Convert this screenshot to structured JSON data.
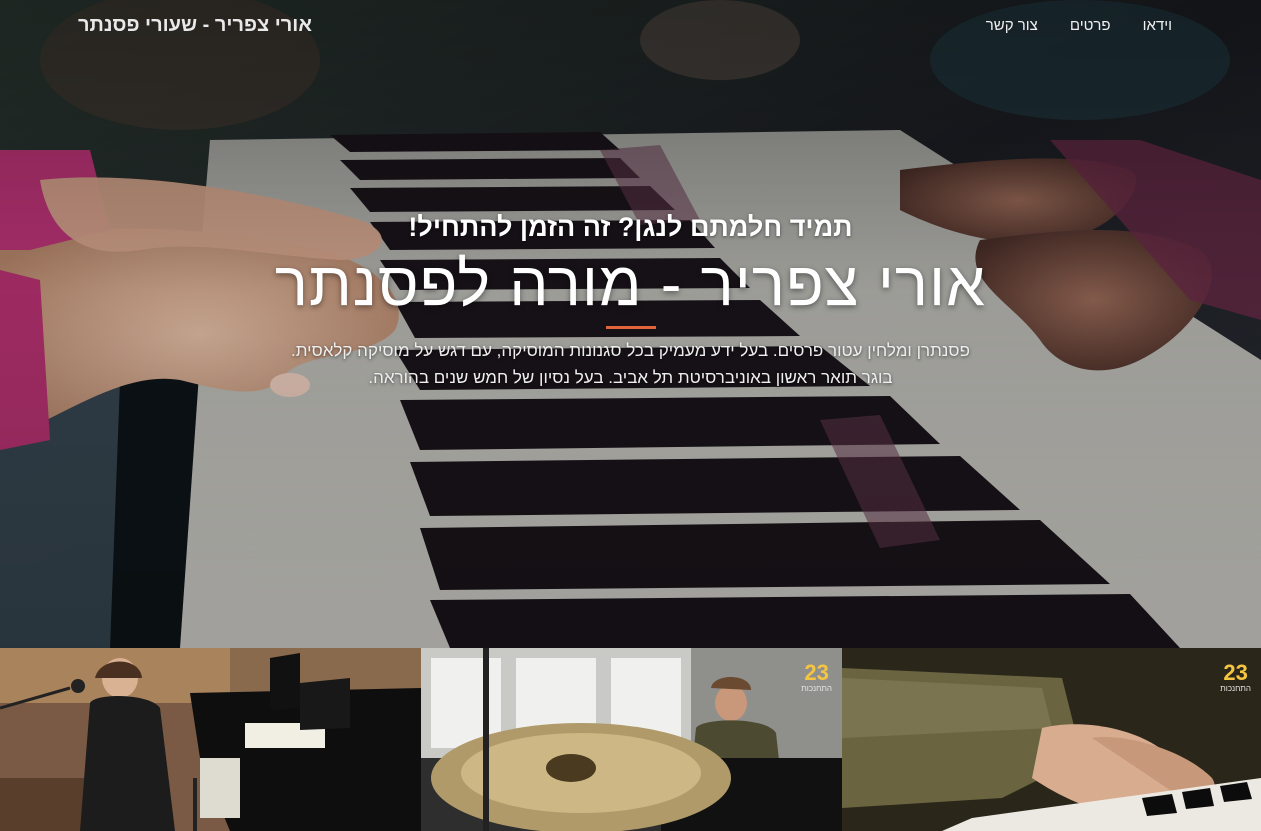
{
  "nav": {
    "brand": "אורי צפריר - שעורי פסנתר",
    "links": [
      {
        "label": "צור קשר"
      },
      {
        "label": "פרטים"
      },
      {
        "label": "וידאו"
      }
    ]
  },
  "header": {
    "tagline": "תמיד חלמתם לנגן?  זה הזמן להתחיל!",
    "headline": "אורי צפריר - מורה לפסנתר",
    "intro": "פסנתרן ומלחין עטור פרסים. בעל ידע מעמיק בכל סגנונות המוסיקה, עם דגש על מוסיקה קלאסית. בוגר תואר ראשון באוניברסיטת תל אביב. בעל נסיון של חמש שנים בהוראה."
  },
  "gallery": {
    "items": [
      {
        "name": "concert-hall-piano"
      },
      {
        "name": "drums-and-pianist",
        "logo": "23",
        "logo_sub": "התחנכות"
      },
      {
        "name": "hands-on-piano",
        "logo": "23",
        "logo_sub": "התחנכות"
      }
    ]
  },
  "colors": {
    "accent": "#e0663a",
    "logo": "#f5c542"
  }
}
